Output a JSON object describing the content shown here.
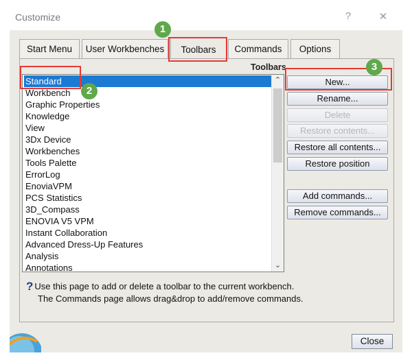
{
  "window": {
    "title": "Customize",
    "help_glyph": "?",
    "close_glyph": "✕"
  },
  "tabs": [
    {
      "label": "Start Menu",
      "active": false
    },
    {
      "label": "User Workbenches",
      "active": false
    },
    {
      "label": "Toolbars",
      "active": true
    },
    {
      "label": "Commands",
      "active": false
    },
    {
      "label": "Options",
      "active": false
    }
  ],
  "toolbars_label": "Toolbars",
  "toolbar_list": {
    "selected": "Standard",
    "items": [
      "Standard",
      "Workbench",
      "Graphic Properties",
      "Knowledge",
      "View",
      "3Dx Device",
      "Workbenches",
      "Tools Palette",
      "ErrorLog",
      "EnoviaVPM",
      "PCS Statistics",
      "3D_Compass",
      "ENOVIA V5 VPM",
      "Instant Collaboration",
      "Advanced Dress-Up Features",
      "Analysis",
      "Annotations"
    ]
  },
  "buttons": {
    "new": "New...",
    "rename": "Rename...",
    "delete": "Delete",
    "restore_contents": "Restore contents...",
    "restore_all": "Restore all contents...",
    "restore_position": "Restore position",
    "add_commands": "Add commands...",
    "remove_commands": "Remove commands...",
    "close": "Close"
  },
  "help": {
    "icon": "?",
    "line1": "Use this page to add or delete a toolbar to the current workbench.",
    "line2": "The Commands page allows drag&drop to add/remove commands."
  },
  "callouts": [
    "1",
    "2",
    "3"
  ],
  "colors": {
    "selection": "#1c7ad2",
    "highlight_box": "#e53935",
    "badge": "#5fa84b",
    "dialog_bg": "#eceae4"
  }
}
